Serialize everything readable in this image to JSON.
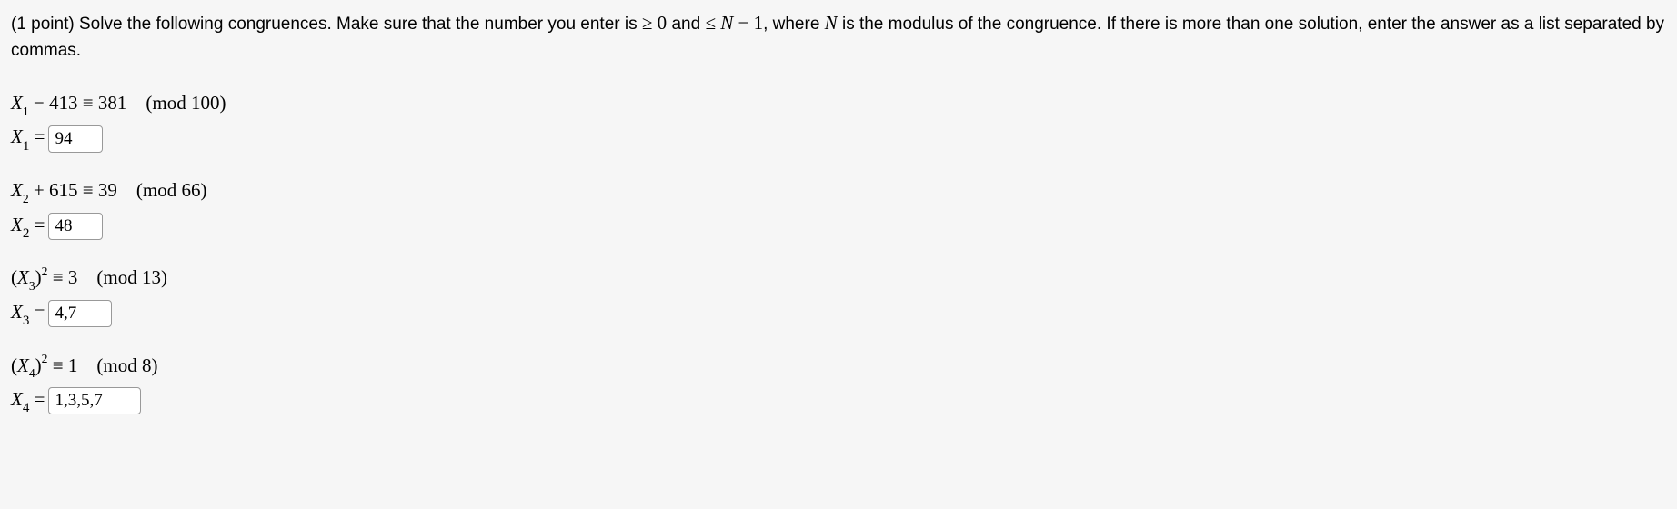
{
  "instructions": {
    "prefix": "(1 point) Solve the following congruences. Make sure that the number you enter is ",
    "cond1": "≥ 0",
    "and": " and ",
    "cond2": "≤ ",
    "nvar": "N",
    "minus1": " − 1",
    "mid": ", where ",
    "nvar2": "N",
    "suffix": " is the modulus of the congruence. If there is more than one solution, enter the answer as a list separated by commas."
  },
  "problems": [
    {
      "var": "X",
      "subscript": "1",
      "expr_before": " − 413 ≡ 381",
      "mod": "(mod  100)",
      "answer_label_var": "X",
      "answer_label_sub": "1",
      "equals": " = ",
      "value": "94"
    },
    {
      "var": "X",
      "subscript": "2",
      "expr_before": " + 615 ≡ 39",
      "mod": "(mod  66)",
      "answer_label_var": "X",
      "answer_label_sub": "2",
      "equals": " = ",
      "value": "48"
    },
    {
      "var_open": "(",
      "var": "X",
      "subscript": "3",
      "var_close": ")",
      "superscript": "2",
      "expr_before": " ≡ 3",
      "mod": "(mod  13)",
      "answer_label_var": "X",
      "answer_label_sub": "3",
      "equals": " = ",
      "value": "4,7"
    },
    {
      "var_open": "(",
      "var": "X",
      "subscript": "4",
      "var_close": ")",
      "superscript": "2",
      "expr_before": " ≡ 1",
      "mod": "(mod  8)",
      "answer_label_var": "X",
      "answer_label_sub": "4",
      "equals": " = ",
      "value": "1,3,5,7"
    }
  ]
}
